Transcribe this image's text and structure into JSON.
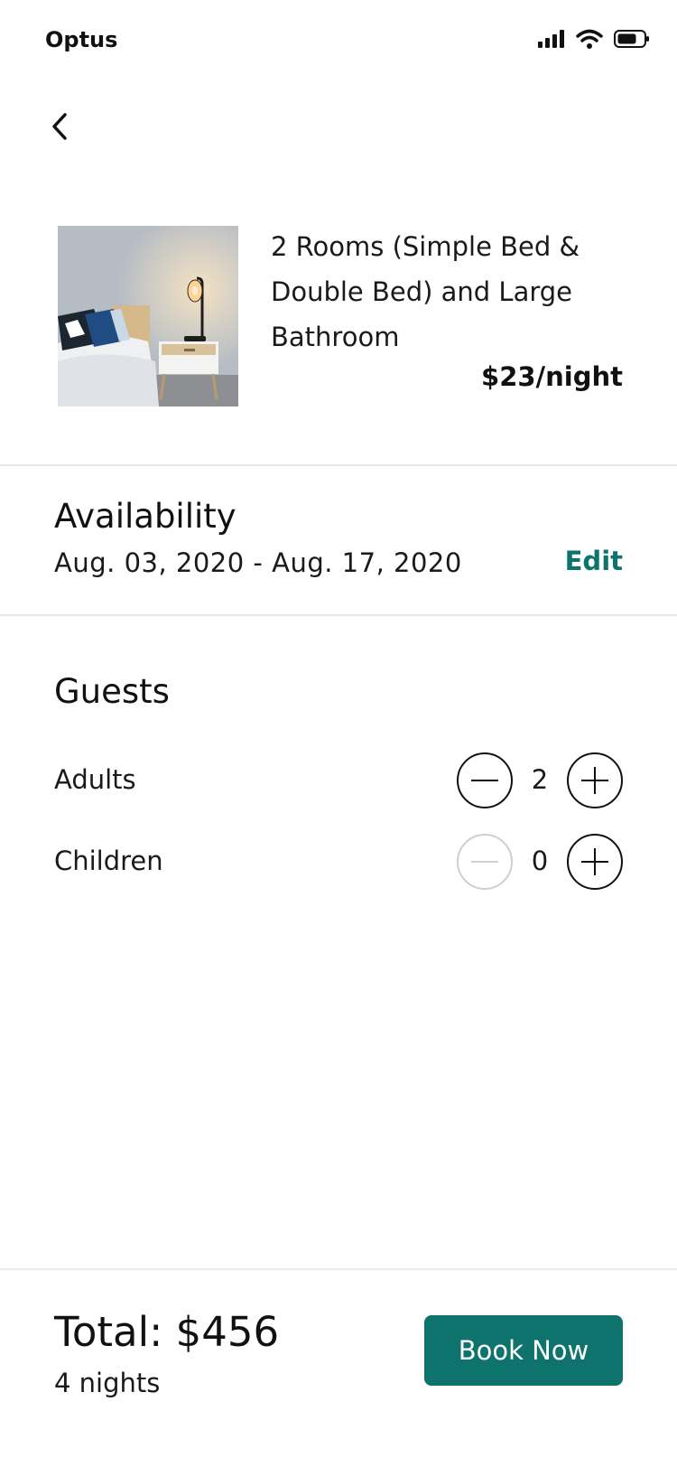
{
  "status_bar": {
    "carrier": "Optus",
    "icons": [
      "signal-icon",
      "wifi-icon",
      "battery-icon"
    ]
  },
  "nav": {
    "back_icon": "chevron-left-icon"
  },
  "room": {
    "title": "2 Rooms (Simple Bed & Double Bed) and Large Bathroom",
    "price": "$23/night"
  },
  "availability": {
    "title": "Availability",
    "dates": "Aug. 03, 2020 - Aug. 17, 2020",
    "edit_label": "Edit"
  },
  "guests": {
    "title": "Guests",
    "rows": [
      {
        "label": "Adults",
        "value": "2",
        "minus_enabled": true
      },
      {
        "label": "Children",
        "value": "0",
        "minus_enabled": false
      }
    ]
  },
  "footer": {
    "total": "Total: $456",
    "nights": "4 nights",
    "book_label": "Book Now"
  },
  "colors": {
    "accent": "#0e736c",
    "divider": "#e8e8e8",
    "disabled": "#cfcfcf"
  }
}
